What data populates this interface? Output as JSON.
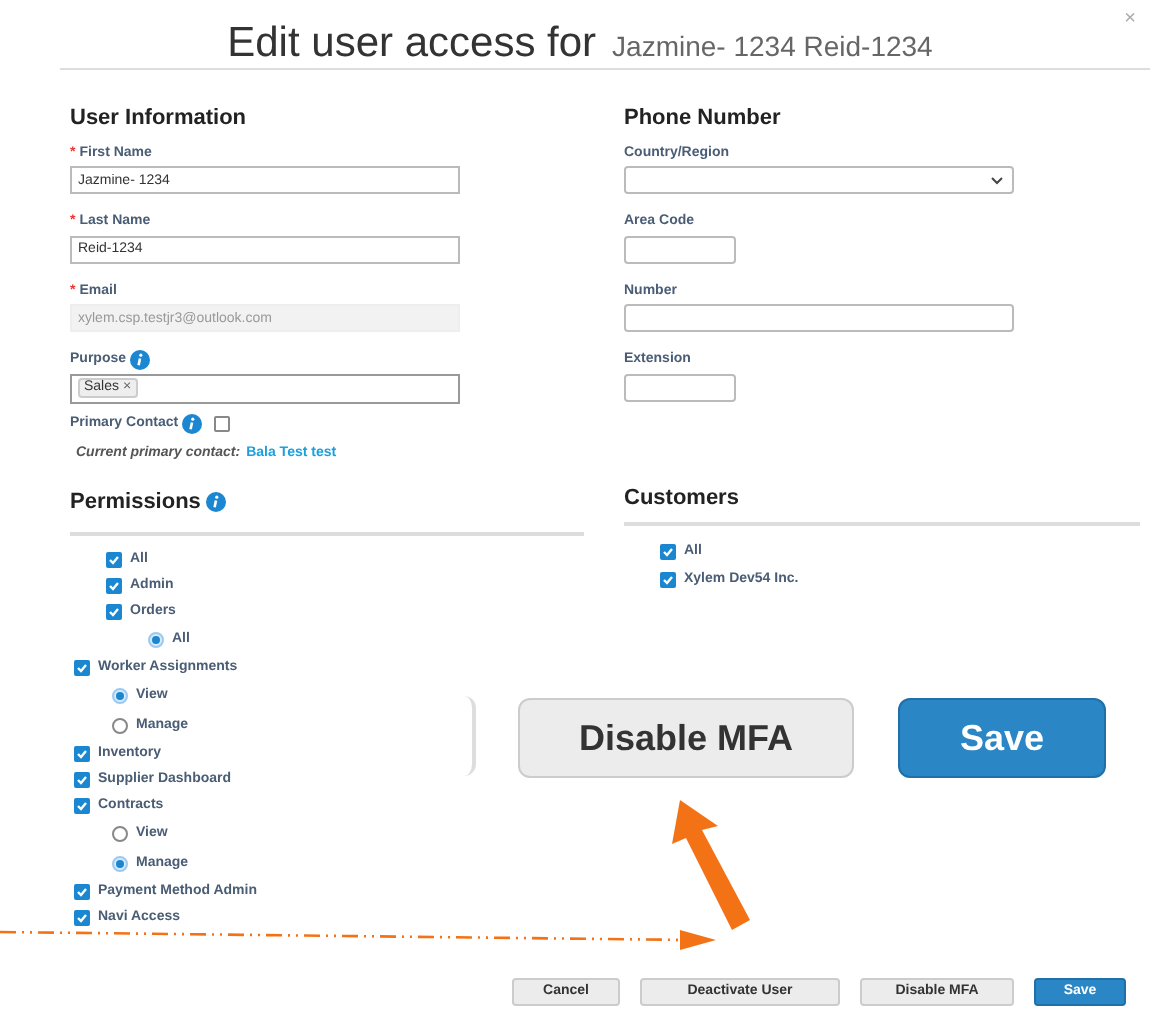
{
  "dialog": {
    "title": "Edit user access for",
    "subtitle": "Jazmine- 1234 Reid-1234",
    "close": "×"
  },
  "user_information": {
    "heading": "User Information",
    "fields": [
      {
        "label": "First Name",
        "required_mark": "*",
        "value": "Jazmine- 1234",
        "disabled": false
      },
      {
        "label": "Last Name",
        "required_mark": "*",
        "value": "Reid-1234",
        "disabled": false
      },
      {
        "label": "Email",
        "required_mark": "*",
        "value": "xylem.csp.testjr3@outlook.com",
        "disabled": true
      }
    ],
    "purpose": {
      "label": "Purpose",
      "tags": [
        {
          "label": "Sales",
          "remove": "×"
        }
      ]
    },
    "primary_contact": {
      "label": "Primary Contact",
      "checked": false
    },
    "current_primary": {
      "label": "Current primary contact:",
      "name": "Bala Test test"
    }
  },
  "phone_number": {
    "heading": "Phone Number",
    "fields": [
      {
        "label": "Country/Region",
        "kind": "select"
      },
      {
        "label": "Area Code",
        "kind": "short"
      },
      {
        "label": "Number",
        "kind": "text"
      },
      {
        "label": "Extension",
        "kind": "short"
      }
    ]
  },
  "permissions": {
    "heading": "Permissions",
    "items": [
      {
        "kind": "checkbox",
        "label": "All",
        "checked": true,
        "indented": true
      },
      {
        "kind": "checkbox",
        "label": "Admin",
        "checked": true,
        "indented": true
      },
      {
        "kind": "checkbox",
        "label": "Orders",
        "checked": true,
        "indented": true,
        "children": [
          {
            "kind": "radio",
            "label": "All",
            "selected": true
          }
        ]
      },
      {
        "kind": "checkbox",
        "label": "Worker Assignments",
        "checked": true,
        "indented": false,
        "children": [
          {
            "kind": "radio",
            "label": "View",
            "selected": true
          },
          {
            "kind": "radio",
            "label": "Manage",
            "selected": false
          }
        ]
      },
      {
        "kind": "checkbox",
        "label": "Inventory",
        "checked": true,
        "indented": false
      },
      {
        "kind": "checkbox",
        "label": "Supplier Dashboard",
        "checked": true,
        "indented": false
      },
      {
        "kind": "checkbox",
        "label": "Contracts",
        "checked": true,
        "indented": false,
        "children": [
          {
            "kind": "radio",
            "label": "View",
            "selected": false
          },
          {
            "kind": "radio",
            "label": "Manage",
            "selected": true
          }
        ]
      },
      {
        "kind": "checkbox",
        "label": "Payment Method Admin",
        "checked": true,
        "indented": false
      },
      {
        "kind": "checkbox",
        "label": "Navi Access",
        "checked": true,
        "indented": false
      }
    ]
  },
  "customers": {
    "heading": "Customers",
    "items": [
      {
        "label": "All",
        "checked": true
      },
      {
        "label": "Xylem Dev54 Inc.",
        "checked": true
      }
    ]
  },
  "callout": {
    "buttons": [
      {
        "label": "Disable MFA",
        "kind": "secondary"
      },
      {
        "label": "Save",
        "kind": "primary"
      }
    ]
  },
  "footer": {
    "buttons": [
      {
        "label": "Cancel",
        "kind": "secondary"
      },
      {
        "label": "Deactivate User",
        "kind": "secondary"
      },
      {
        "label": "Disable MFA",
        "kind": "secondary"
      },
      {
        "label": "Save",
        "kind": "primary"
      }
    ]
  }
}
